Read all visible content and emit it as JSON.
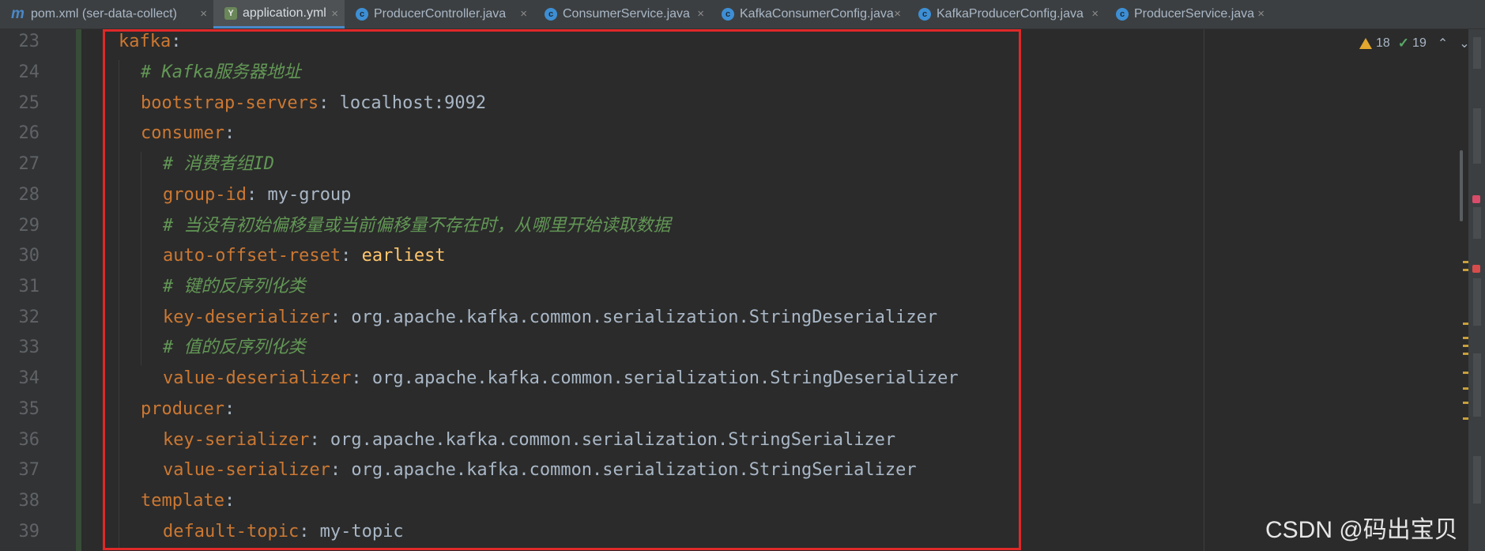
{
  "tabs": [
    {
      "label": "pom.xml (ser-data-collect)",
      "icon": "maven-icon",
      "active": false
    },
    {
      "label": "application.yml",
      "icon": "yaml-icon",
      "active": true
    },
    {
      "label": "ProducerController.java",
      "icon": "java-class-icon",
      "active": false
    },
    {
      "label": "ConsumerService.java",
      "icon": "java-class-icon",
      "active": false
    },
    {
      "label": "KafkaConsumerConfig.java",
      "icon": "java-class-icon",
      "active": false
    },
    {
      "label": "KafkaProducerConfig.java",
      "icon": "java-class-icon",
      "active": false
    },
    {
      "label": "ProducerService.java",
      "icon": "java-class-icon",
      "active": false
    }
  ],
  "close_glyph": "×",
  "inspections": {
    "warnings": "18",
    "weak_warnings": "19"
  },
  "line_numbers": [
    "23",
    "24",
    "25",
    "26",
    "27",
    "28",
    "29",
    "30",
    "31",
    "32",
    "33",
    "34",
    "35",
    "36",
    "37",
    "38",
    "39"
  ],
  "code": {
    "l23": {
      "key": "kafka",
      "colon": ":"
    },
    "l24": {
      "comment": "# Kafka服务器地址"
    },
    "l25": {
      "key": "bootstrap-servers",
      "colon": ":",
      "value": " localhost:9092"
    },
    "l26": {
      "key": "consumer",
      "colon": ":"
    },
    "l27": {
      "comment": "# 消费者组ID"
    },
    "l28": {
      "key": "group-id",
      "colon": ":",
      "value": " my-group"
    },
    "l29": {
      "comment": "# 当没有初始偏移量或当前偏移量不存在时，从哪里开始读取数据"
    },
    "l30": {
      "key": "auto-offset-reset",
      "colon": ":",
      "value": " earliest"
    },
    "l31": {
      "comment": "# 键的反序列化类"
    },
    "l32": {
      "key": "key-deserializer",
      "colon": ":",
      "value": " org.apache.kafka.common.serialization.StringDeserializer"
    },
    "l33": {
      "comment": "# 值的反序列化类"
    },
    "l34": {
      "key": "value-deserializer",
      "colon": ":",
      "value": " org.apache.kafka.common.serialization.StringDeserializer"
    },
    "l35": {
      "key": "producer",
      "colon": ":"
    },
    "l36": {
      "key": "key-serializer",
      "colon": ":",
      "value": " org.apache.kafka.common.serialization.StringSerializer"
    },
    "l37": {
      "key": "value-serializer",
      "colon": ":",
      "value": " org.apache.kafka.common.serialization.StringSerializer"
    },
    "l38": {
      "key": "template",
      "colon": ":"
    },
    "l39": {
      "key": "default-topic",
      "colon": ":",
      "value": " my-topic"
    }
  },
  "watermark": "CSDN @码出宝贝",
  "colors": {
    "key": "#cc7832",
    "comment": "#629755",
    "value": "#a9b7c6",
    "keyword": "#ffc66d",
    "highlight_box": "#e02828",
    "accent_tab": "#4a88c7"
  }
}
